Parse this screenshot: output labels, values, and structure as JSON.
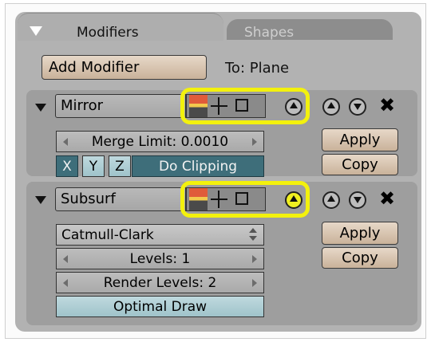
{
  "tabs": {
    "modifiers": "Modifiers",
    "shapes": "Shapes"
  },
  "toolbar": {
    "add_modifier": "Add Modifier",
    "to_label": "To: Plane"
  },
  "mirror": {
    "name": "Mirror",
    "merge_limit": "Merge Limit: 0.0010",
    "axis_x": "X",
    "axis_y": "Y",
    "axis_z": "Z",
    "do_clipping": "Do Clipping",
    "apply": "Apply",
    "copy": "Copy"
  },
  "subsurf": {
    "name": "Subsurf",
    "subdivision_type": "Catmull-Clark",
    "levels": "Levels: 1",
    "render_levels": "Render Levels: 2",
    "optimal_draw": "Optimal Draw",
    "apply": "Apply",
    "copy": "Copy"
  },
  "close_symbol": "✖",
  "colors": {
    "highlight": "#f3f10d",
    "toggle_on": "#3e6e7a",
    "button": "#d8c4ae"
  }
}
